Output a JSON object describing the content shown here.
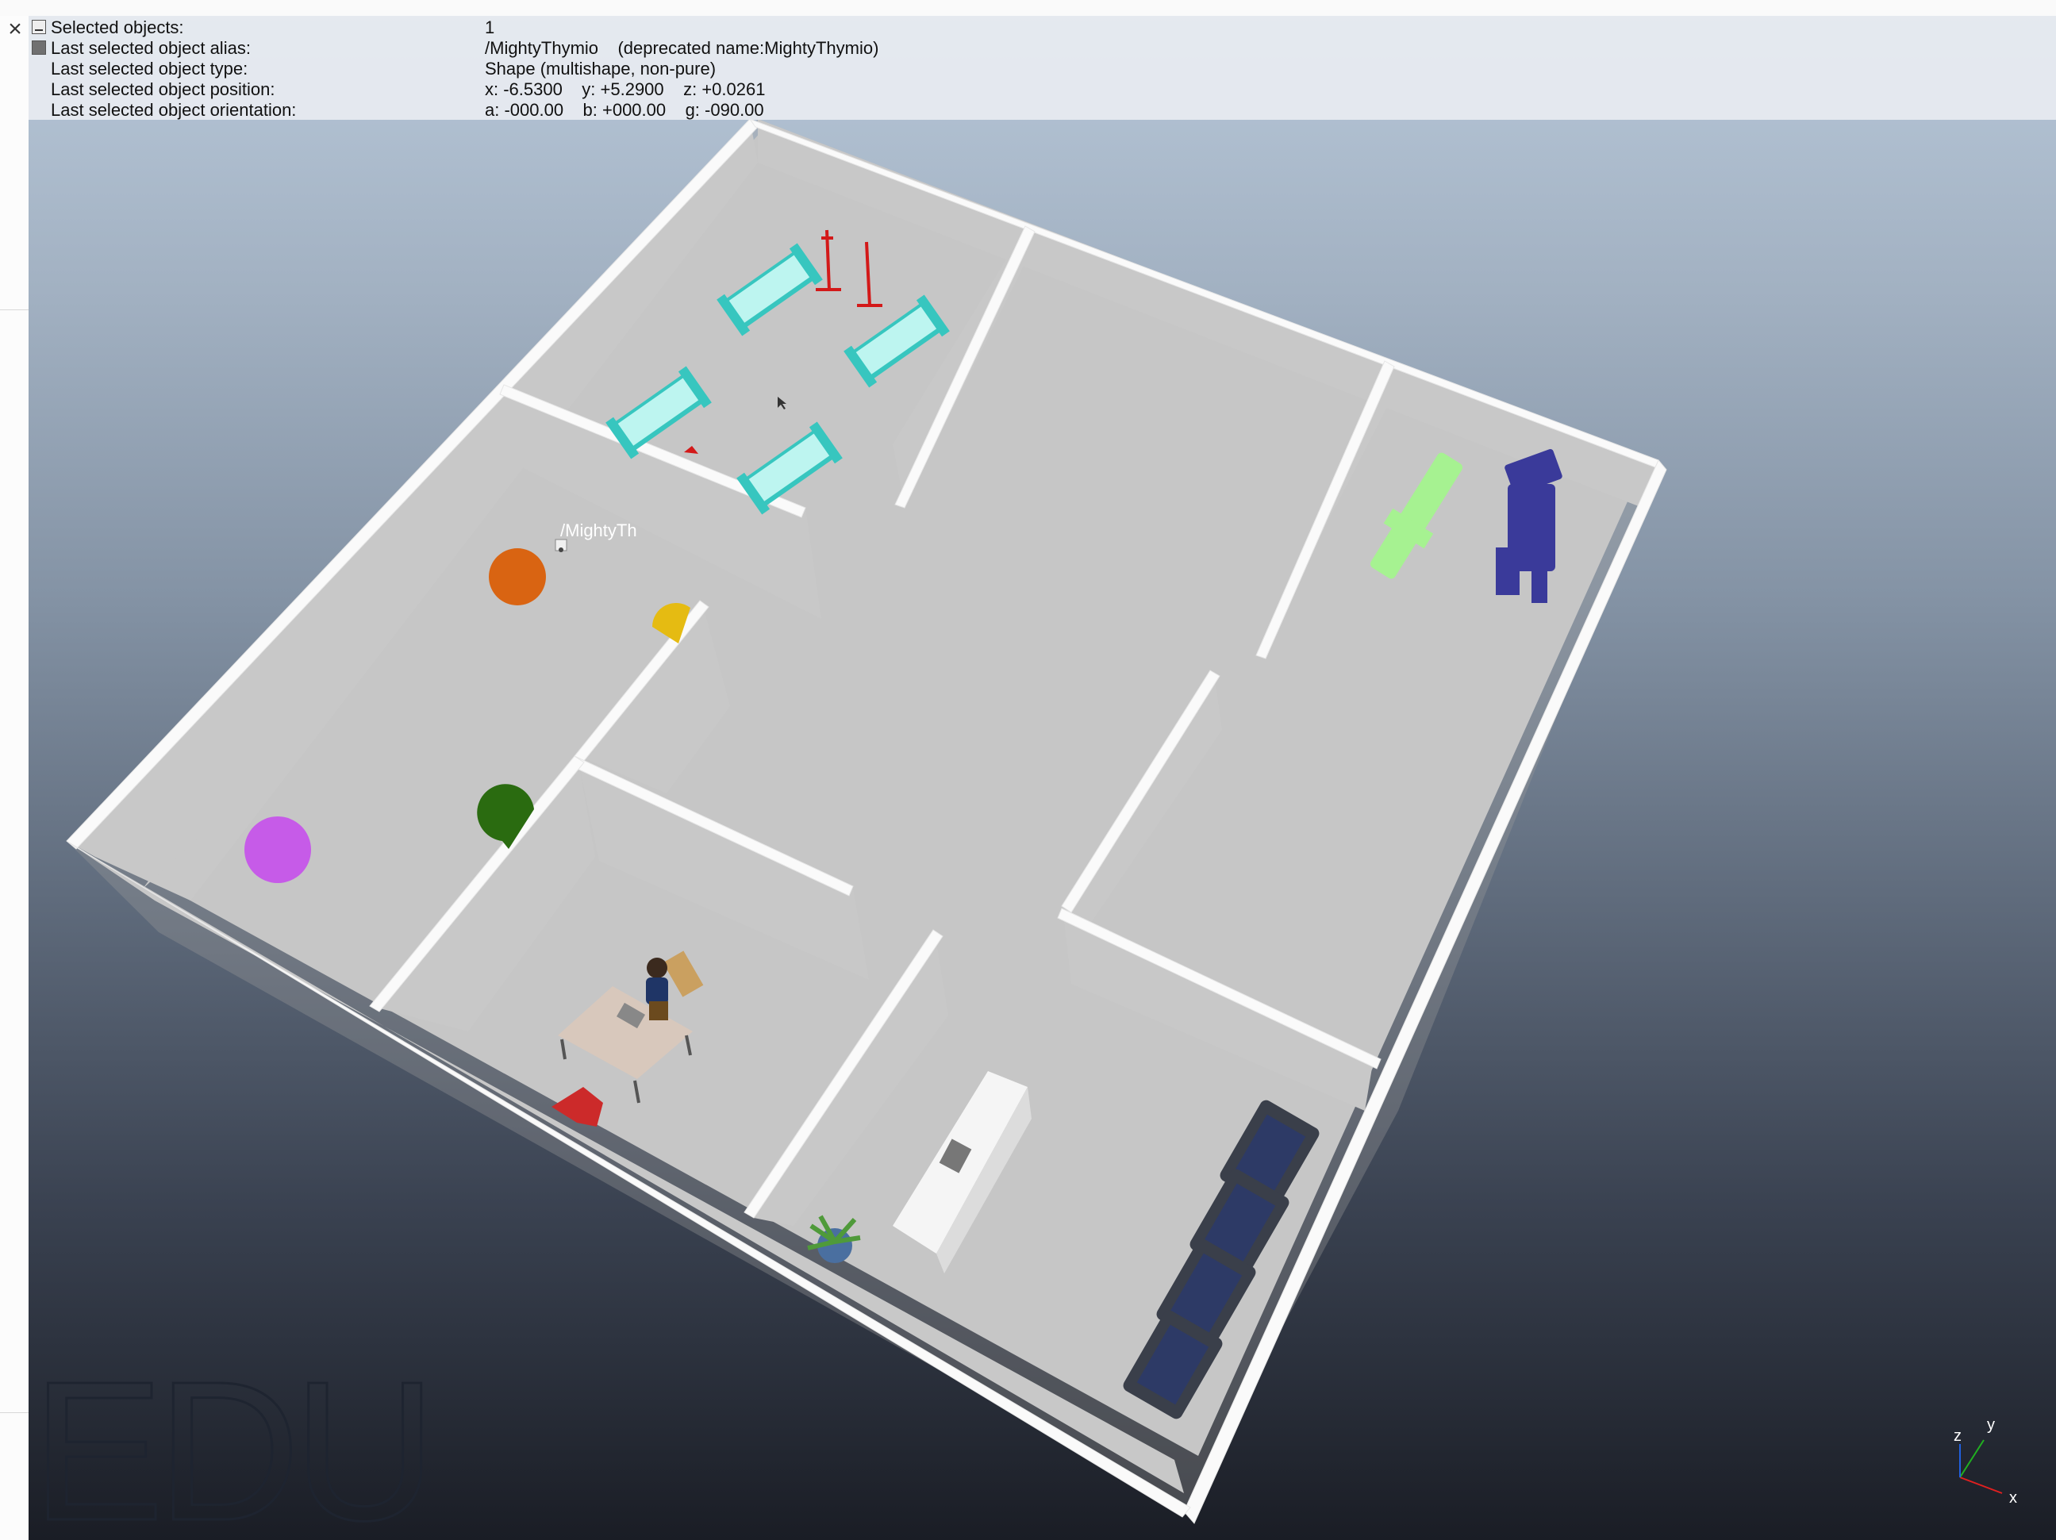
{
  "window": {
    "close_glyph": "×"
  },
  "info_panel": {
    "rows": [
      {
        "label": "Selected objects:",
        "value": "1"
      },
      {
        "label": "Last selected object alias:",
        "value": "/MightyThymio    (deprecated name:MightyThymio)"
      },
      {
        "label": "Last selected object type:",
        "value": "Shape (multishape, non-pure)"
      },
      {
        "label": "Last selected object position:",
        "value": "x: -6.5300    y: +5.2900    z: +0.0261"
      },
      {
        "label": "Last selected object orientation:",
        "value": "a: -000.00    b: +000.00    g: -090.00"
      }
    ]
  },
  "scene": {
    "robot_label": "/MightyTh",
    "watermark": "EDU",
    "axis_labels": {
      "x": "x",
      "y": "y",
      "z": "z"
    },
    "colors": {
      "wall_top": "#fafafa",
      "wall_side": "#c8c8c8",
      "floor": "#c6c6c6",
      "hospital_bed": "#37c6bf",
      "iv_stand": "#d31919",
      "ball_orange": "#d96412",
      "ball_yellow": "#e5bb12",
      "ball_green": "#2a6b10",
      "ball_purple": "#c65be8",
      "exam_chair": "#a6f291",
      "ultrasound_machine": "#3a3a9a",
      "desk": "#d8c8bc",
      "red_chair": "#cc2a2a",
      "armchair": "#2d3a66",
      "cabinet": "#f5f5f5",
      "plant": "#4f9a3a"
    }
  }
}
